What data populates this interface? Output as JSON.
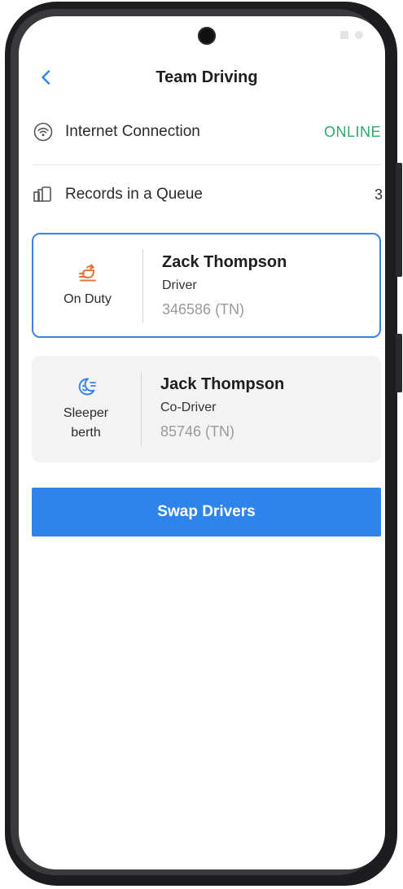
{
  "header": {
    "title": "Team Driving",
    "back_icon": "chevron-left-icon"
  },
  "internet": {
    "label": "Internet Connection",
    "status": "ONLINE",
    "icon": "wifi-icon",
    "status_color": "#2fa86a"
  },
  "queue": {
    "label": "Records in a Queue",
    "count": "3",
    "icon": "records-queue-icon"
  },
  "drivers": [
    {
      "status": "On Duty",
      "status_icon": "on-duty-icon",
      "status_color": "#e8733a",
      "name": "Zack Thompson",
      "role": "Driver",
      "id": "346586 (TN)",
      "selected": true
    },
    {
      "status": "Sleeper berth",
      "status_icon": "sleeper-berth-icon",
      "status_color": "#3b82e6",
      "name": "Jack Thompson",
      "role": "Co-Driver",
      "id": "85746 (TN)",
      "selected": false
    }
  ],
  "actions": {
    "swap_label": "Swap Drivers"
  },
  "colors": {
    "accent": "#2f84ec",
    "online": "#2fa86a",
    "selected_border": "#3b82e6"
  }
}
